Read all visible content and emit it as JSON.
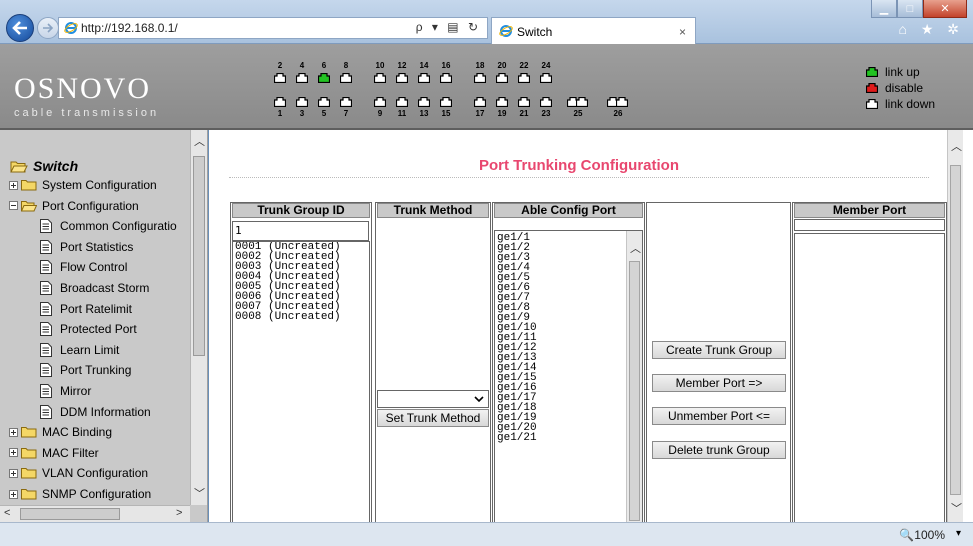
{
  "browser": {
    "url": "http://192.168.0.1/",
    "tab_title": "Switch",
    "tab_close": "×",
    "address_tools": "ρ ▾ ▤ ↻",
    "window_buttons": {
      "minimize": "▁",
      "maximize": "□",
      "close": "✕"
    },
    "toolbar_icons": "⌂ ★ ✲",
    "zoom": "🔍100%",
    "zoom_caret": "▾"
  },
  "device": {
    "logo": "OSNOVO",
    "logo_sub": "cable transmission",
    "ports_top": [
      {
        "num": "2",
        "state": "link_down"
      },
      {
        "num": "4",
        "state": "link_down"
      },
      {
        "num": "6",
        "state": "link_up"
      },
      {
        "num": "8",
        "state": "link_down"
      },
      {
        "num": "10",
        "state": "link_down"
      },
      {
        "num": "12",
        "state": "link_down"
      },
      {
        "num": "14",
        "state": "link_down"
      },
      {
        "num": "16",
        "state": "link_down"
      },
      {
        "num": "18",
        "state": "link_down"
      },
      {
        "num": "20",
        "state": "link_down"
      },
      {
        "num": "22",
        "state": "link_down"
      },
      {
        "num": "24",
        "state": "link_down"
      }
    ],
    "ports_bottom": [
      {
        "num": "1",
        "state": "link_down"
      },
      {
        "num": "3",
        "state": "link_down"
      },
      {
        "num": "5",
        "state": "link_down"
      },
      {
        "num": "7",
        "state": "link_down"
      },
      {
        "num": "9",
        "state": "link_down"
      },
      {
        "num": "11",
        "state": "link_down"
      },
      {
        "num": "13",
        "state": "link_down"
      },
      {
        "num": "15",
        "state": "link_down"
      },
      {
        "num": "17",
        "state": "link_down"
      },
      {
        "num": "19",
        "state": "link_down"
      },
      {
        "num": "21",
        "state": "link_down"
      },
      {
        "num": "23",
        "state": "link_down"
      },
      {
        "num": "25",
        "state": "link_down"
      },
      {
        "num": "26",
        "state": "link_down"
      }
    ],
    "legend": [
      {
        "label": "link up",
        "state": "link_up"
      },
      {
        "label": "disable",
        "state": "disable"
      },
      {
        "label": "link down",
        "state": "link_down"
      }
    ],
    "colors": {
      "link_up": "#22c322",
      "disable": "#e01b1b",
      "link_down": "#ffffff"
    }
  },
  "sidebar": {
    "root": "Switch",
    "items": [
      {
        "label": "System Configuration",
        "type": "folder",
        "expanded": false,
        "level": 0
      },
      {
        "label": "Port Configuration",
        "type": "folder",
        "expanded": true,
        "level": 0
      },
      {
        "label": "Common Configuratio",
        "type": "page",
        "level": 1
      },
      {
        "label": "Port Statistics",
        "type": "page",
        "level": 1
      },
      {
        "label": "Flow Control",
        "type": "page",
        "level": 1
      },
      {
        "label": "Broadcast Storm",
        "type": "page",
        "level": 1
      },
      {
        "label": "Port Ratelimit",
        "type": "page",
        "level": 1
      },
      {
        "label": "Protected Port",
        "type": "page",
        "level": 1
      },
      {
        "label": "Learn Limit",
        "type": "page",
        "level": 1
      },
      {
        "label": "Port Trunking",
        "type": "page",
        "level": 1
      },
      {
        "label": "Mirror",
        "type": "page",
        "level": 1
      },
      {
        "label": "DDM Information",
        "type": "page",
        "level": 1
      },
      {
        "label": "MAC Binding",
        "type": "folder",
        "expanded": false,
        "level": 0
      },
      {
        "label": "MAC Filter",
        "type": "folder",
        "expanded": false,
        "level": 0
      },
      {
        "label": "VLAN Configuration",
        "type": "folder",
        "expanded": false,
        "level": 0
      },
      {
        "label": "SNMP Configuration",
        "type": "folder",
        "expanded": false,
        "level": 0
      }
    ]
  },
  "main": {
    "title": "Port Trunking Configuration",
    "title_color": "#e8476f",
    "columns": {
      "trunk_group_id": "Trunk Group ID",
      "trunk_method": "Trunk Method",
      "able_config_port": "Able Config Port",
      "member_port": "Member Port"
    },
    "group_id_value": "1",
    "trunk_groups": [
      "0001 (Uncreated)",
      "0002 (Uncreated)",
      "0003 (Uncreated)",
      "0004 (Uncreated)",
      "0005 (Uncreated)",
      "0006 (Uncreated)",
      "0007 (Uncreated)",
      "0008 (Uncreated)"
    ],
    "able_ports": [
      "ge1/1",
      "ge1/2",
      "ge1/3",
      "ge1/4",
      "ge1/5",
      "ge1/6",
      "ge1/7",
      "ge1/8",
      "ge1/9",
      "ge1/10",
      "ge1/11",
      "ge1/12",
      "ge1/13",
      "ge1/14",
      "ge1/15",
      "ge1/16",
      "ge1/17",
      "ge1/18",
      "ge1/19",
      "ge1/20",
      "ge1/21"
    ],
    "trunk_method_value": "",
    "buttons": {
      "set_trunk_method": "Set Trunk Method",
      "create_trunk_group": "Create Trunk Group",
      "member_port": "Member Port =>",
      "unmember_port": "Unmember Port <=",
      "delete_trunk_group": "Delete trunk Group"
    }
  }
}
